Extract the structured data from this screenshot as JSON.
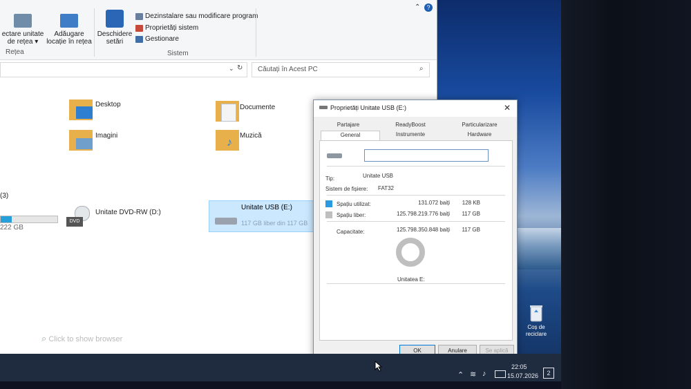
{
  "ribbon": {
    "network_drive_label": "ectare unitate",
    "network_drive_label2": "de rețea ▾",
    "add_location_label": "Adăugare",
    "add_location_label2": "locație în rețea",
    "open_settings_label": "Deschidere",
    "open_settings_label2": "setări",
    "uninstall_label": "Dezinstalare sau modificare program",
    "system_props_label": "Proprietăți sistem",
    "manage_label": "Gestionare",
    "group_network": "Rețea",
    "group_system": "Sistem"
  },
  "search": {
    "placeholder": "Căutați în Acest PC"
  },
  "folders": [
    {
      "label": "Desktop"
    },
    {
      "label": "Documente"
    },
    {
      "label": "Imagini"
    },
    {
      "label": "Muzică"
    }
  ],
  "drives_section": {
    "count_label": "(3)",
    "partial_size": "222 GB"
  },
  "drives": {
    "dvd_label": "Unitate DVD-RW (D:)",
    "dvd_badge": "DVD",
    "usb_label": "Unitate USB (E:)",
    "usb_free": "117 GB liber din 117 GB"
  },
  "bottom_search": {
    "text": "Click to show browser"
  },
  "dialog": {
    "title": "Proprietăți Unitate USB (E:)",
    "tabs_top": [
      "Partajare",
      "ReadyBoost",
      "Particularizare"
    ],
    "tabs_bottom": [
      "General",
      "Instrumente",
      "Hardware"
    ],
    "type_label": "Tip:",
    "type_value": "Unitate USB",
    "fs_label": "Sistem de fișiere:",
    "fs_value": "FAT32",
    "used_label": "Spațiu utilizat:",
    "used_bytes": "131.072 baiți",
    "used_size": "128 KB",
    "free_label": "Spațiu liber:",
    "free_bytes": "125.798.219.776 baiți",
    "free_size": "117 GB",
    "capacity_label": "Capacitate:",
    "capacity_bytes": "125.798.350.848 baiți",
    "capacity_size": "117 GB",
    "drive_label": "Unitatea E:",
    "used_fraction": 1e-06,
    "ok_label": "OK",
    "cancel_label": "Anulare",
    "apply_label": "Se aplică"
  },
  "desktop": {
    "recycle_label": "Coș de",
    "recycle_label2": "reciclare"
  },
  "taskbar": {
    "time": "22:05",
    "date": "15.07.2026",
    "notification_count": "2"
  },
  "colors": {
    "used": "#2b9be0",
    "free": "#bfbfbf",
    "accent": "#0078d7",
    "taskbar": "#1f2b3e"
  }
}
